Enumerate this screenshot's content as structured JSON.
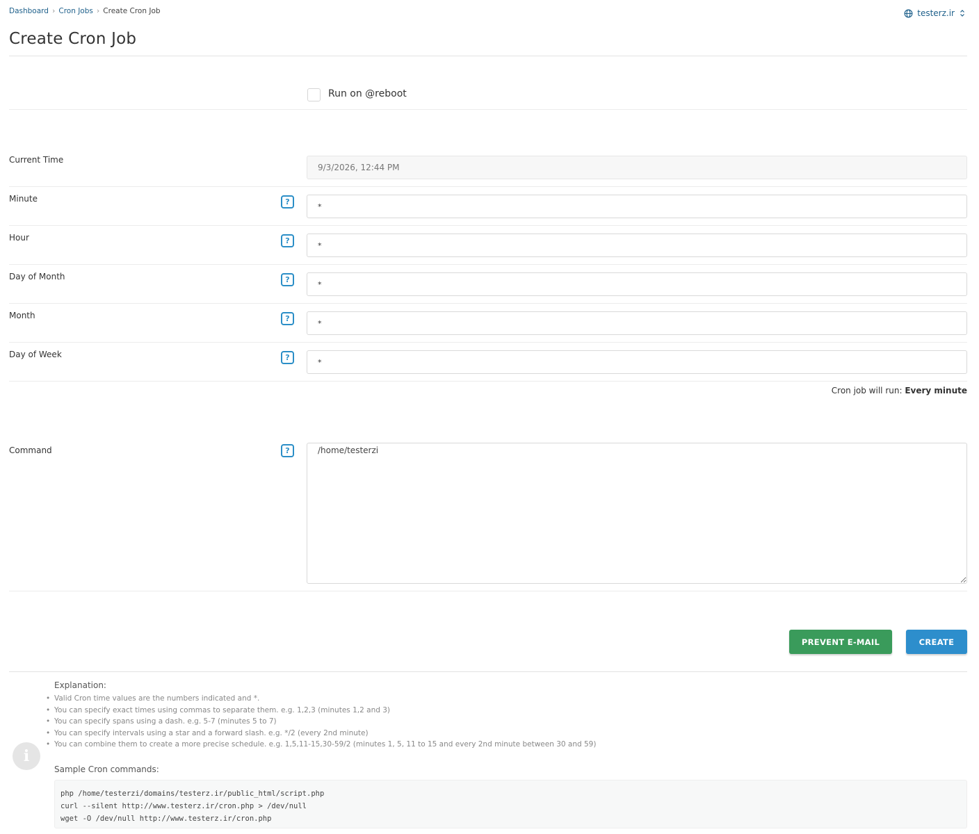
{
  "breadcrumb": {
    "items": [
      "Dashboard",
      "Cron Jobs"
    ],
    "current": "Create Cron Job"
  },
  "domain_selector": {
    "value": "testerz.ir",
    "icon": "globe-icon"
  },
  "page_title": "Create Cron Job",
  "reboot": {
    "label": "Run on @reboot",
    "checked": false
  },
  "form": {
    "current_time": {
      "label": "Current Time",
      "value": "9/3/2026, 12:44 PM"
    },
    "minute": {
      "label": "Minute",
      "value": "*"
    },
    "hour": {
      "label": "Hour",
      "value": "*"
    },
    "day_of_month": {
      "label": "Day of Month",
      "value": "*"
    },
    "month": {
      "label": "Month",
      "value": "*"
    },
    "day_of_week": {
      "label": "Day of Week",
      "value": "*"
    },
    "help_symbol": "?"
  },
  "summary": {
    "prefix": "Cron job will run:",
    "value": "Every minute"
  },
  "command": {
    "label": "Command",
    "value": "/home/testerzi"
  },
  "buttons": {
    "prevent_email": "PREVENT E-MAIL",
    "create": "CREATE"
  },
  "colors": {
    "link": "#1d5f8a",
    "help_accent": "#2b8ec7",
    "green_button": "#3a9b5b",
    "blue_button": "#2d8ecc"
  },
  "explanation": {
    "title": "Explanation:",
    "items": [
      "Valid Cron time values are the numbers indicated and *.",
      "You can specify exact times using commas to separate them. e.g. 1,2,3 (minutes 1,2 and 3)",
      "You can specify spans using a dash. e.g. 5-7 (minutes 5 to 7)",
      "You can specify intervals using a star and a forward slash. e.g. */2 (every 2nd minute)",
      "You can combine them to create a more precise schedule. e.g. 1,5,11-15,30-59/2 (minutes 1, 5, 11 to 15 and every 2nd minute between 30 and 59)"
    ]
  },
  "samples": {
    "title": "Sample Cron commands:",
    "lines": [
      "php /home/testerzi/domains/testerz.ir/public_html/script.php",
      "curl --silent http://www.testerz.ir/cron.php > /dev/null",
      "wget -O /dev/null http://www.testerz.ir/cron.php"
    ]
  }
}
